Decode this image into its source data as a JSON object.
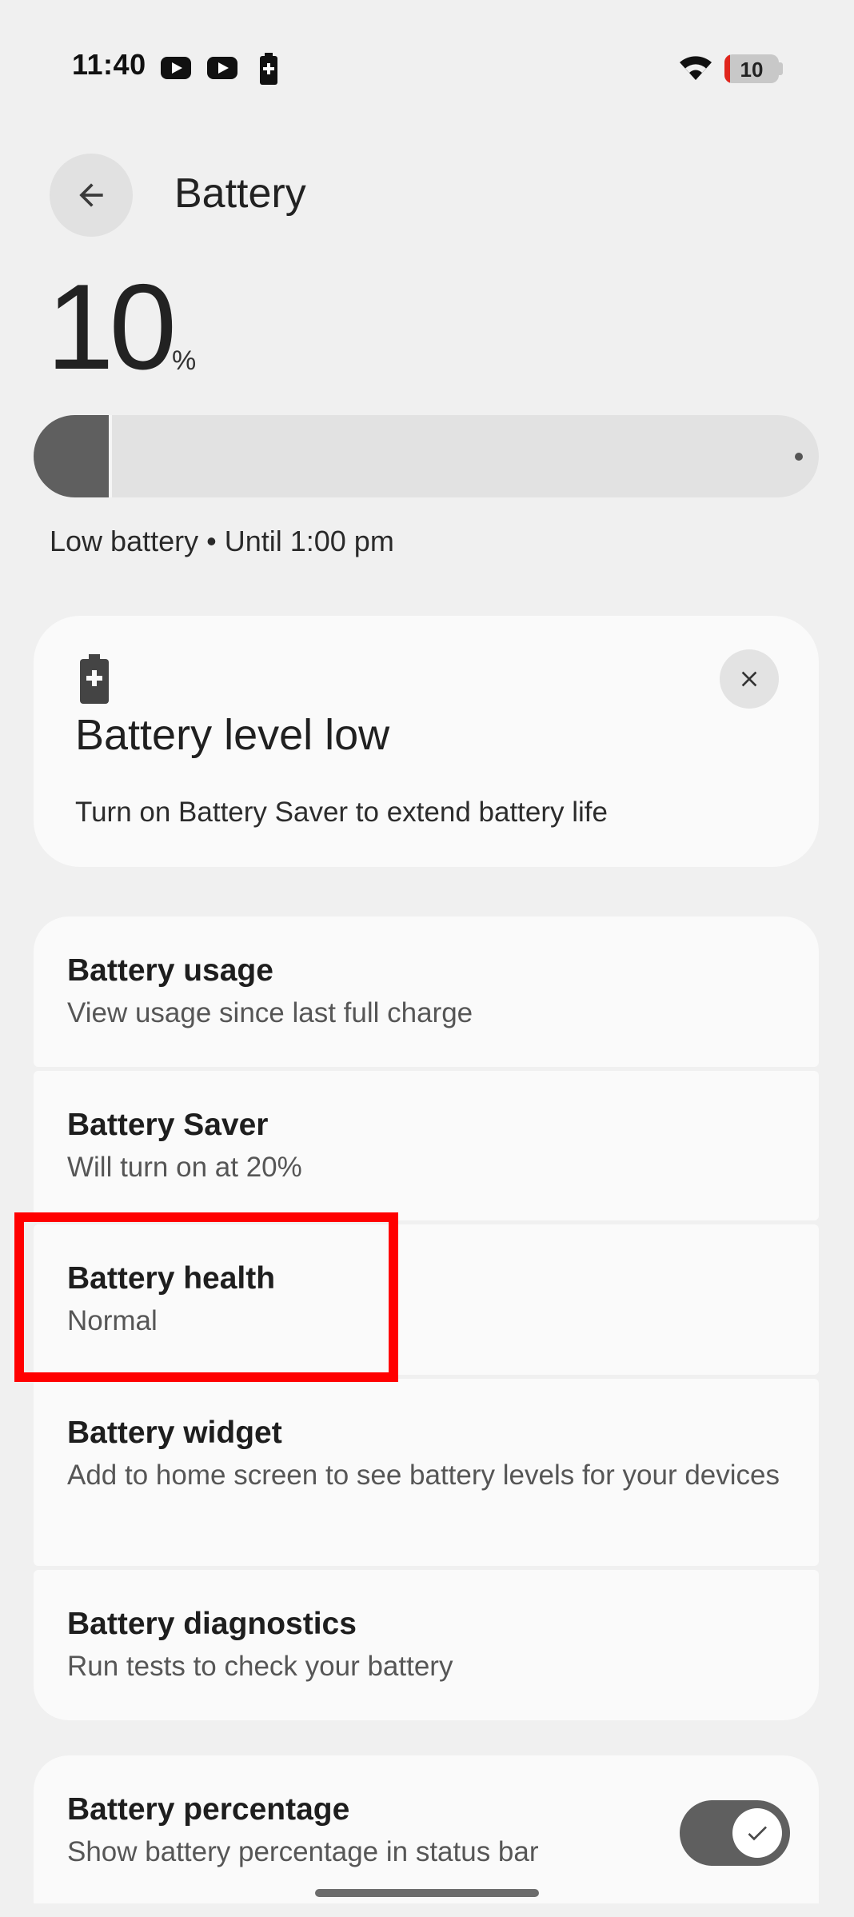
{
  "status_bar": {
    "time": "11:40",
    "notification_icons": [
      "youtube-icon",
      "youtube-icon",
      "battery-charging-icon"
    ],
    "wifi_icon": "wifi-icon",
    "battery_level": "10",
    "battery_fraction": 0.1,
    "battery_low_color": "#e0261d"
  },
  "header": {
    "back_icon": "arrow-left-icon",
    "title": "Battery"
  },
  "level": {
    "value": "10",
    "unit": "%",
    "fraction": 0.1,
    "status": "Low battery • Until 1:00 pm"
  },
  "alert": {
    "icon": "battery-alert-icon",
    "title": "Battery level low",
    "body": "Turn on Battery Saver to extend battery life",
    "close_icon": "close-icon"
  },
  "settings": {
    "items": [
      {
        "title": "Battery usage",
        "subtitle": "View usage since last full charge"
      },
      {
        "title": "Battery Saver",
        "subtitle": "Will turn on at 20%"
      },
      {
        "title": "Battery health",
        "subtitle": "Normal"
      },
      {
        "title": "Battery widget",
        "subtitle": "Add to home screen to see battery levels for your devices"
      },
      {
        "title": "Battery diagnostics",
        "subtitle": "Run tests to check your battery"
      }
    ],
    "percentage": {
      "title": "Battery percentage",
      "subtitle": "Show battery percentage in status bar",
      "enabled": true
    }
  },
  "colors": {
    "background": "#f0f0f0",
    "card": "#fafafa",
    "accent_dark": "#5f5f5f",
    "highlight": "#ff0000"
  }
}
